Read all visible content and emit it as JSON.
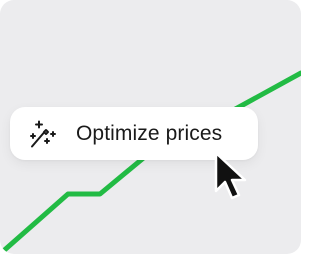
{
  "optimize_button": {
    "label": "Optimize prices",
    "icon": "magic-sparkles-icon"
  },
  "trend_line": {
    "color": "#22bb44"
  },
  "cursor": {
    "icon": "mouse-pointer-icon"
  }
}
